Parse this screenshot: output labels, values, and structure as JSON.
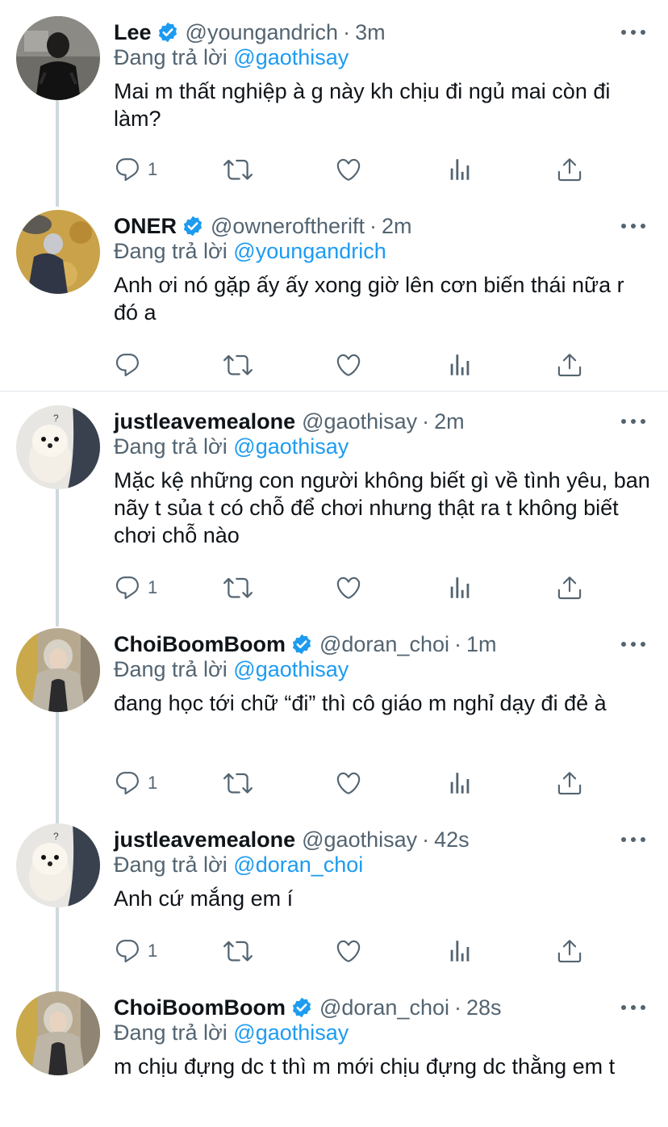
{
  "tweets": [
    {
      "name": "Lee",
      "verified": true,
      "handle": "@youngandrich",
      "time": "3m",
      "replying_label": "Đang trả lời",
      "replying_to": "@gaothisay",
      "text": "Mai m thất nghiệp à g này kh chịu đi ngủ mai còn đi làm?",
      "reply_count": "1"
    },
    {
      "name": "ONER",
      "verified": true,
      "handle": "@owneroftherift",
      "time": "2m",
      "replying_label": "Đang trả lời",
      "replying_to": "@youngandrich",
      "text": "Anh ơi nó gặp ấy ấy xong giờ lên cơn biến thái nữa r đó a",
      "reply_count": ""
    },
    {
      "name": "justleavemealone",
      "verified": false,
      "handle": "@gaothisay",
      "time": "2m",
      "replying_label": "Đang trả lời",
      "replying_to": "@gaothisay",
      "text": "Mặc kệ những con người không biết gì về tình yêu, ban nãy t sủa t có chỗ để chơi nhưng thật ra t không biết chơi chỗ nào",
      "reply_count": "1"
    },
    {
      "name": "ChoiBoomBoom",
      "verified": true,
      "handle": "@doran_choi",
      "time": "1m",
      "replying_label": "Đang trả lời",
      "replying_to": "@gaothisay",
      "text": "đang học tới chữ “đi” thì cô giáo m nghỉ dạy đi đẻ à",
      "reply_count": "1"
    },
    {
      "name": "justleavemealone",
      "verified": false,
      "handle": "@gaothisay",
      "time": "42s",
      "replying_label": "Đang trả lời",
      "replying_to": "@doran_choi",
      "text": "Anh cứ mắng em í",
      "reply_count": "1"
    },
    {
      "name": "ChoiBoomBoom",
      "verified": true,
      "handle": "@doran_choi",
      "time": "28s",
      "replying_label": "Đang trả lời",
      "replying_to": "@gaothisay",
      "text": "m chịu đựng dc t thì m mới chịu đựng dc thằng em t",
      "reply_count": ""
    }
  ],
  "colors": {
    "accent": "#1d9bf0",
    "muted": "#536471",
    "thread_line": "#cfd9de"
  },
  "icons": [
    "reply-icon",
    "retweet-icon",
    "like-icon",
    "views-icon",
    "share-icon",
    "verified-badge-icon",
    "more-options-icon"
  ]
}
